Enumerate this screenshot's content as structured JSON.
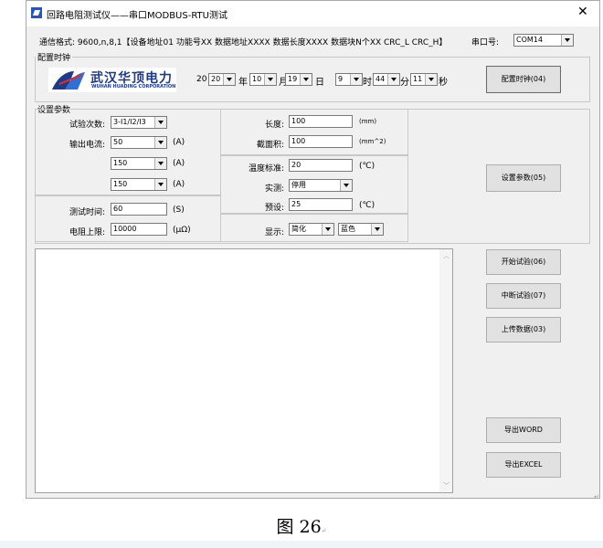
{
  "window": {
    "title": "回路电阻测试仪——串口MODBUS-RTU测试",
    "close_glyph": "✕"
  },
  "header": {
    "comm_format": "通信格式: 9600,n,8,1【设备地址01 功能号XX 数据地址XXXX 数据长度XXXX 数据块N个XX CRC_L CRC_H】",
    "port_label": "串口号:",
    "port_value": "COM14"
  },
  "clock": {
    "legend": "配置时钟",
    "logo_cn": "武汉华顶电力",
    "logo_en": "WUHAN HUADING CORPORATION",
    "year_prefix": "20",
    "year": "20",
    "year_unit": "年",
    "month": "10",
    "month_unit": "月",
    "day": "19",
    "day_unit": "日",
    "hour": "9",
    "hour_unit": "时",
    "minute": "44",
    "minute_unit": "分",
    "second": "11",
    "second_unit": "秒",
    "button": "配置时钟(04)"
  },
  "settings": {
    "legend": "设置参数",
    "test_count_label": "试验次数:",
    "test_count": "3-I1/I2/I3",
    "current_label": "输出电流:",
    "current1": "50",
    "current2": "150",
    "current3": "150",
    "current_unit": "(A)",
    "test_time_label": "测试时间:",
    "test_time": "60",
    "test_time_unit": "(S)",
    "resistance_label": "电阻上限:",
    "resistance": "10000",
    "resistance_unit": "(μΩ)",
    "length_label": "长度:",
    "length": "100",
    "length_unit": "(mm)",
    "area_label": "截面积:",
    "area": "100",
    "area_unit": "(mm^2)",
    "temp_std_label": "温度标准:",
    "temp_std": "20",
    "temp_unit": "(℃)",
    "measured_label": "实测:",
    "measured": "停用",
    "preset_label": "预设:",
    "preset": "25",
    "display_label": "显示:",
    "display_lang": "简化",
    "display_color": "蓝色",
    "button": "设置参数(05)"
  },
  "actions": {
    "start": "开始试验(06)",
    "stop": "中断试验(07)",
    "upload": "上传数据(03)",
    "export_word": "导出WORD",
    "export_excel": "导出EXCEL"
  },
  "caption": {
    "text": "图 26",
    "mark": "↵"
  }
}
